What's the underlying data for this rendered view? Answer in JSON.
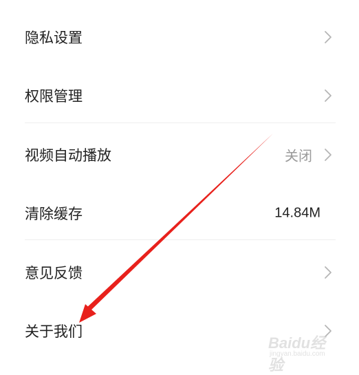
{
  "settings": {
    "items": [
      {
        "label": "隐私设置"
      },
      {
        "label": "权限管理"
      },
      {
        "label": "视频自动播放",
        "value": "关闭"
      },
      {
        "label": "清除缓存",
        "value": "14.84M"
      },
      {
        "label": "意见反馈"
      },
      {
        "label": "关于我们"
      }
    ]
  },
  "annotation": {
    "arrow_color": "#e8211c"
  },
  "watermark": {
    "brand": "Baidu经验",
    "url": "jingyan.baidu.com"
  }
}
